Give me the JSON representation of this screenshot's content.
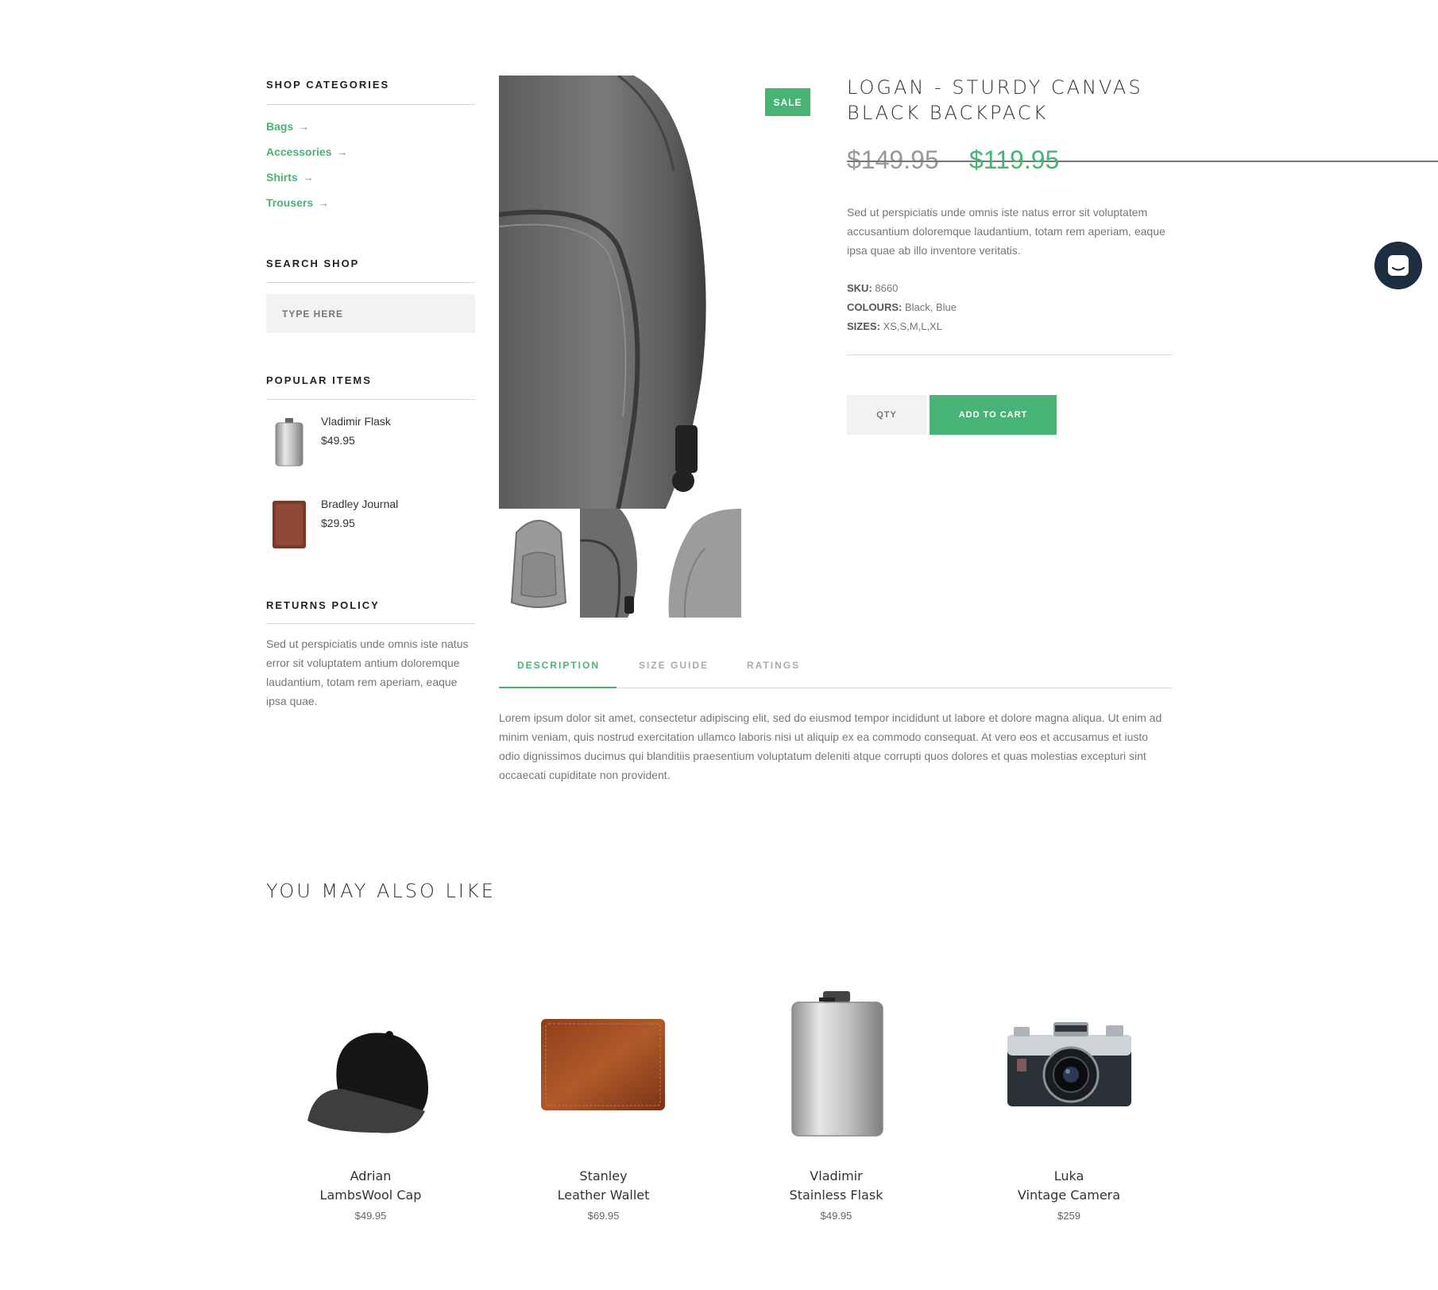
{
  "sidebar": {
    "categories_title": "SHOP CATEGORIES",
    "categories": [
      "Bags",
      "Accessories",
      "Shirts",
      "Trousers"
    ],
    "search_title": "SEARCH SHOP",
    "search_placeholder": "TYPE HERE",
    "popular_title": "POPULAR ITEMS",
    "popular_items": [
      {
        "name": "Vladimir Flask",
        "price": "$49.95"
      },
      {
        "name": "Bradley Journal",
        "price": "$29.95"
      }
    ],
    "returns_title": "RETURNS POLICY",
    "returns_text": "Sed ut perspiciatis unde omnis iste natus error sit voluptatem antium doloremque laudantium, totam rem aperiam, eaque ipsa quae."
  },
  "product": {
    "badge": "SALE",
    "title": "LOGAN - STURDY CANVAS BLACK BACKPACK",
    "old_price": "$149.95",
    "new_price": "$119.95",
    "description": "Sed ut perspiciatis unde omnis iste natus error sit voluptatem accusantium doloremque laudantium, totam rem aperiam, eaque ipsa quae ab illo inventore veritatis.",
    "sku_label": "SKU:",
    "sku": "8660",
    "colours_label": "COLOURS:",
    "colours": "Black, Blue",
    "sizes_label": "SIZES:",
    "sizes": "XS,S,M,L,XL",
    "qty_placeholder": "QTY",
    "add_to_cart": "ADD TO CART"
  },
  "tabs": {
    "items": [
      "DESCRIPTION",
      "SIZE GUIDE",
      "RATINGS"
    ],
    "active": "DESCRIPTION",
    "content": "Lorem ipsum dolor sit amet, consectetur adipiscing elit, sed do eiusmod tempor incididunt ut labore et dolore magna aliqua. Ut enim ad minim veniam, quis nostrud exercitation ullamco laboris nisi ut aliquip ex ea commodo consequat. At vero eos et accusamus et iusto odio dignissimos ducimus qui blanditiis praesentium voluptatum deleniti atque corrupti quos dolores et quas molestias excepturi sint occaecati cupiditate non provident."
  },
  "related": {
    "title": "YOU MAY ALSO LIKE",
    "items": [
      {
        "line1": "Adrian",
        "line2": "LambsWool Cap",
        "price": "$49.95"
      },
      {
        "line1": "Stanley",
        "line2": "Leather Wallet",
        "price": "$69.95"
      },
      {
        "line1": "Vladimir",
        "line2": "Stainless Flask",
        "price": "$49.95"
      },
      {
        "line1": "Luka",
        "line2": "Vintage Camera",
        "price": "$259"
      }
    ]
  },
  "colors": {
    "accent": "#47b475",
    "chat": "#1b2d3f"
  }
}
